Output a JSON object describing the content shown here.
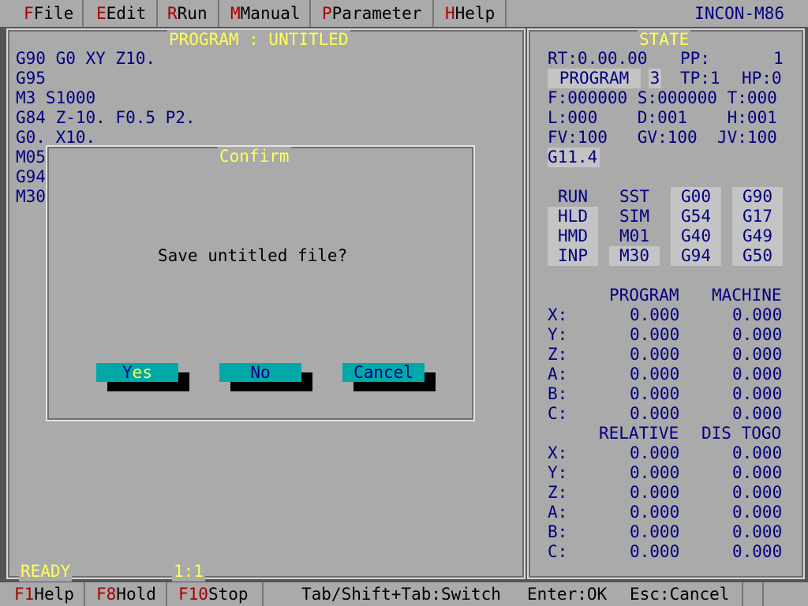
{
  "menu": [
    {
      "hot": "F",
      "label": "File"
    },
    {
      "hot": "E",
      "label": "Edit"
    },
    {
      "hot": "R",
      "label": "Run"
    },
    {
      "hot": "M",
      "label": "Manual"
    },
    {
      "hot": "P",
      "label": "Parameter"
    },
    {
      "hot": "H",
      "label": "Help"
    }
  ],
  "brand": "INCON-M86",
  "program": {
    "title": "PROGRAM : UNTITLED",
    "lines": [
      "G90 G0 XY Z10.",
      "G95",
      "M3 S1000",
      "G84 Z-10. F0.5 P2.",
      "G0. X10.",
      "M05",
      "G94",
      "M30"
    ],
    "status": "READY",
    "position": "1:1"
  },
  "state": {
    "title": "STATE",
    "rt": "RT:0.00.00",
    "pp_label": "PP:",
    "pp_value": "1",
    "mode": "PROGRAM",
    "mode_num": "3",
    "tp": "TP:1",
    "hp": "HP:0",
    "row_f": "F:000000 S:000000 T:000",
    "row_l": "L:000    D:001    H:001",
    "row_fv": "FV:100   GV:100  JV:100",
    "gcode": "G11.4",
    "flags_col1": [
      "RUN",
      "HLD",
      "HMD",
      "INP"
    ],
    "flags_col2": [
      "SST",
      "SIM",
      "M01",
      "M30"
    ],
    "gcodes_col1": [
      "G00",
      "G54",
      "G40",
      "G94"
    ],
    "gcodes_col2": [
      "G90",
      "G17",
      "G49",
      "G50"
    ],
    "hdr_program": "PROGRAM",
    "hdr_machine": "MACHINE",
    "hdr_relative": "RELATIVE",
    "hdr_distogo": "DIS TOGO",
    "coords1": [
      {
        "axis": "X:",
        "a": "0.000",
        "b": "0.000"
      },
      {
        "axis": "Y:",
        "a": "0.000",
        "b": "0.000"
      },
      {
        "axis": "Z:",
        "a": "0.000",
        "b": "0.000"
      },
      {
        "axis": "A:",
        "a": "0.000",
        "b": "0.000"
      },
      {
        "axis": "B:",
        "a": "0.000",
        "b": "0.000"
      },
      {
        "axis": "C:",
        "a": "0.000",
        "b": "0.000"
      }
    ],
    "coords2": [
      {
        "axis": "X:",
        "a": "0.000",
        "b": "0.000"
      },
      {
        "axis": "Y:",
        "a": "0.000",
        "b": "0.000"
      },
      {
        "axis": "Z:",
        "a": "0.000",
        "b": "0.000"
      },
      {
        "axis": "A:",
        "a": "0.000",
        "b": "0.000"
      },
      {
        "axis": "B:",
        "a": "0.000",
        "b": "0.000"
      },
      {
        "axis": "C:",
        "a": "0.000",
        "b": "0.000"
      }
    ]
  },
  "dialog": {
    "title": "Confirm",
    "message": "Save untitled file?",
    "yes_hot": "Y",
    "yes_rest": "es",
    "no": "No",
    "cancel": "Cancel"
  },
  "statusbar": {
    "f1_key": "F1",
    "f1_label": "Help",
    "f8_key": "F8",
    "f8_label": "Hold",
    "f10_key": "F10",
    "f10_label": "Stop",
    "hint_switch": "Tab/Shift+Tab:Switch",
    "hint_ok": "Enter:OK",
    "hint_cancel": "Esc:Cancel"
  }
}
